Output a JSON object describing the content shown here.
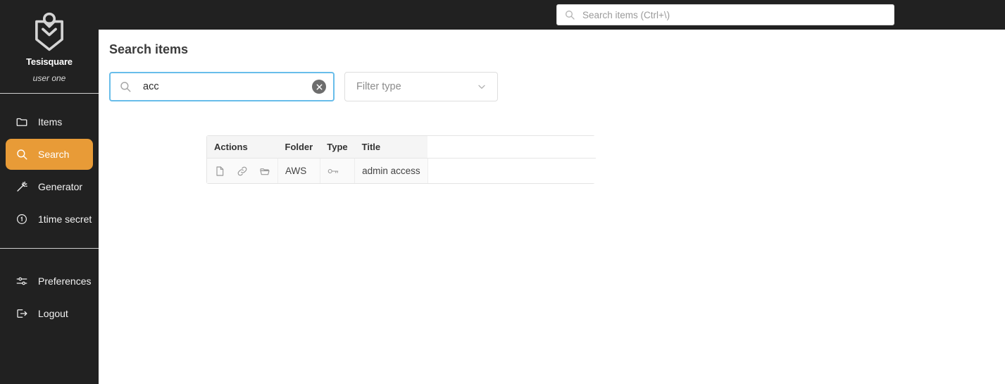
{
  "colors": {
    "sidebar_bg": "#212121",
    "accent_orange": "#e89b37",
    "focus_blue": "#68bdea",
    "content_bg": "#ffffff",
    "table_head_bg": "#f5f5f5",
    "table_cell_bg": "#fafafa"
  },
  "topbar": {
    "search_icon": "search-icon",
    "search_placeholder": "Search items (Ctrl+\\)",
    "search_value": ""
  },
  "sidebar": {
    "logo_icon": "tesisquare-shield-logo",
    "brand_name": "Tesisquare",
    "user_name": "user one",
    "items": [
      {
        "label": "Items",
        "icon": "folder-icon",
        "active": false
      },
      {
        "label": "Search",
        "icon": "search-icon",
        "active": true
      },
      {
        "label": "Generator",
        "icon": "magic-wand-icon",
        "active": false
      },
      {
        "label": "1time secret",
        "icon": "circle-one-icon",
        "active": false
      }
    ],
    "bottom_items": [
      {
        "label": "Preferences",
        "icon": "sliders-icon",
        "active": false
      },
      {
        "label": "Logout",
        "icon": "logout-icon",
        "active": false
      }
    ]
  },
  "main": {
    "title": "Search items",
    "search": {
      "icon": "search-icon",
      "value": "acc",
      "placeholder": "",
      "clear_icon": "clear-circle-icon"
    },
    "filter": {
      "label": "Filter type",
      "chevron_icon": "chevron-down-icon"
    },
    "table": {
      "columns": [
        "Actions",
        "Folder",
        "Type",
        "Title"
      ],
      "rows": [
        {
          "actions": [
            "file-icon",
            "link-icon",
            "folder-icon"
          ],
          "folder": "AWS",
          "type_icon": "key-icon",
          "title": "admin access"
        }
      ]
    }
  }
}
